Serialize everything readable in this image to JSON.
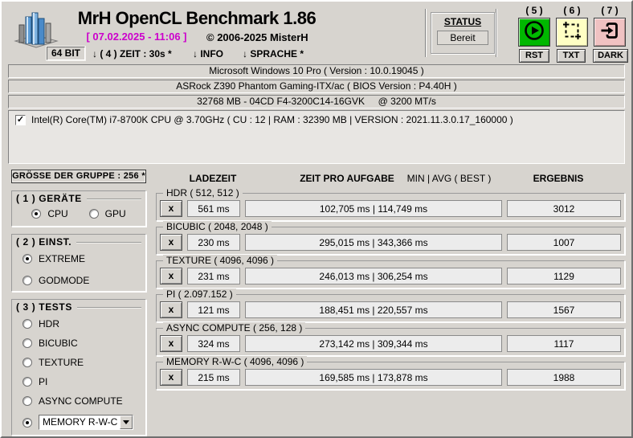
{
  "window": {
    "title": "MrH OpenCL Benchmark 1.86",
    "datetime": "[ 07.02.2025 - 11:06 ]",
    "copyright": "©  2006-2025 MisterH"
  },
  "toolbar": {
    "bit": "64 BIT",
    "zeit": "↓ ( 4 ) ZEIT : 30s *",
    "info": "↓ INFO",
    "sprache": "↓ SPRACHE *"
  },
  "status": {
    "label": "STATUS",
    "value": "Bereit"
  },
  "actions": {
    "run_num": "( 5 )",
    "txt_num": "( 6 )",
    "exit_num": "( 7 )",
    "rst": "RST",
    "txt": "TXT",
    "dark": "DARK"
  },
  "system_info": {
    "os": "Microsoft Windows 10 Pro ( Version : 10.0.19045 )",
    "mainboard": "ASRock Z390 Phantom Gaming-ITX/ac ( BIOS Version : P4.40H )",
    "memory": "32768 MB - 04CD F4-3200C14-16GVK     @ 3200 MT/s",
    "device_check": "✓",
    "device": "Intel(R) Core(TM) i7-8700K CPU @ 3.70GHz ( CU : 12 | RAM : 32390 MB | VERSION : 2021.11.3.0.17_160000 )"
  },
  "sidebar": {
    "group_size": "GRÖSSE DER GRUPPE : 256 *",
    "geraete": {
      "legend": "( 1 ) GERÄTE",
      "options": [
        "CPU",
        "GPU"
      ],
      "selected": "CPU"
    },
    "einst": {
      "legend": "( 2 ) EINST.",
      "options": [
        "EXTREME",
        "GODMODE"
      ],
      "selected": "EXTREME"
    },
    "tests": {
      "legend": "( 3 ) TESTS",
      "options": [
        "HDR",
        "BICUBIC",
        "TEXTURE",
        "PI",
        "ASYNC COMPUTE"
      ],
      "dropdown_value": "MEMORY R-W-C",
      "selected": "MEMORY R-W-C"
    }
  },
  "results": {
    "columns": {
      "ladezeit": "LADEZEIT",
      "aufgabe": "ZEIT PRO AUFGABE",
      "minavg": "MIN | AVG ( BEST )",
      "ergebnis": "ERGEBNIS"
    },
    "remove_label": "x",
    "rows": [
      {
        "name": "HDR ( 512, 512 )",
        "ladezeit": "561 ms",
        "times": "102,705 ms | 114,749 ms",
        "score": "3012"
      },
      {
        "name": "BICUBIC ( 2048, 2048 )",
        "ladezeit": "230 ms",
        "times": "295,015 ms | 343,366 ms",
        "score": "1007"
      },
      {
        "name": "TEXTURE ( 4096, 4096 )",
        "ladezeit": "231 ms",
        "times": "246,013 ms | 306,254 ms",
        "score": "1129"
      },
      {
        "name": "PI ( 2.097.152 )",
        "ladezeit": "121 ms",
        "times": "188,451 ms | 220,557 ms",
        "score": "1567"
      },
      {
        "name": "ASYNC COMPUTE ( 256, 128 )",
        "ladezeit": "324 ms",
        "times": "273,142 ms | 309,344 ms",
        "score": "1117"
      },
      {
        "name": "MEMORY R-W-C ( 4096, 4096 )",
        "ladezeit": "215 ms",
        "times": "169,585 ms | 173,878 ms",
        "score": "1988"
      }
    ]
  },
  "colors": {
    "accent_magenta": "#cc00cc",
    "run_green": "#00b800",
    "txt_yellow": "#ffffc4",
    "exit_pink": "#f0c2c2",
    "window_gray": "#d7d4cf"
  }
}
